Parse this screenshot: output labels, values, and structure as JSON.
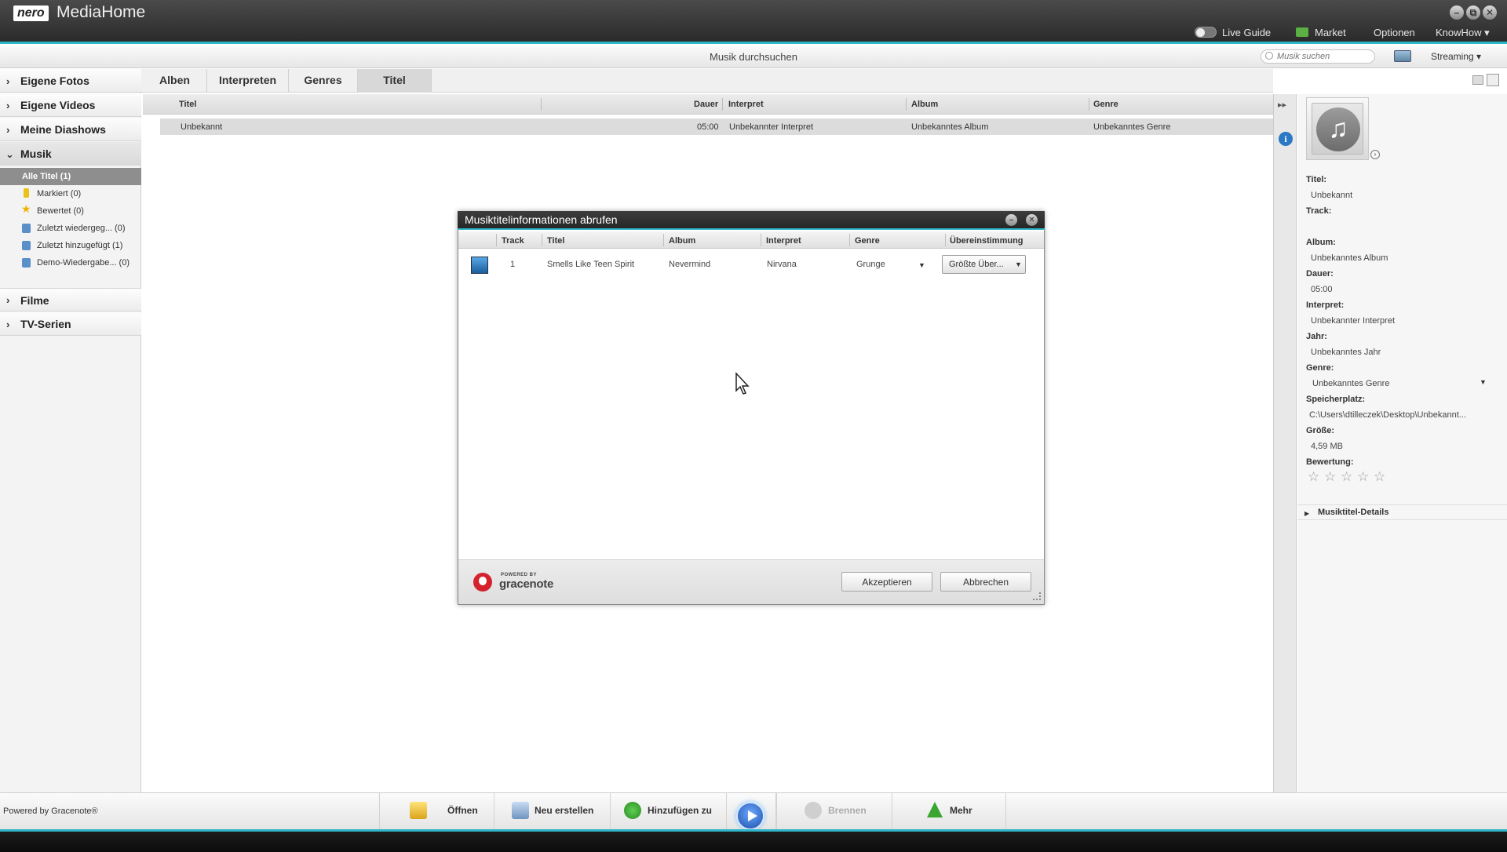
{
  "app": {
    "logo": "nero",
    "name": "MediaHome"
  },
  "window_controls": [
    "–",
    "⧉",
    "✕"
  ],
  "topnav": {
    "live_guide": "Live Guide",
    "market": "Market",
    "options": "Optionen",
    "knowhow": "KnowHow ▾"
  },
  "subheader": {
    "title": "Musik durchsuchen",
    "search_placeholder": "Musik suchen",
    "streaming": "Streaming ▾"
  },
  "sidebar": {
    "categories": [
      "Eigene Fotos",
      "Eigene Videos",
      "Meine Diashows",
      "Musik",
      "Filme",
      "TV-Serien"
    ],
    "music_items": [
      "Alle Titel (1)",
      "Markiert (0)",
      "Bewertet (0)",
      "Zuletzt wiedergeg... (0)",
      "Zuletzt hinzugefügt (1)",
      "Demo-Wiedergabe... (0)"
    ]
  },
  "tabs": [
    "Alben",
    "Interpreten",
    "Genres",
    "Titel"
  ],
  "table": {
    "columns": [
      "Titel",
      "Dauer",
      "Interpret",
      "Album",
      "Genre"
    ],
    "rows": [
      {
        "title": "Unbekannt",
        "duration": "05:00",
        "artist": "Unbekannter Interpret",
        "album": "Unbekanntes Album",
        "genre": "Unbekanntes Genre"
      }
    ]
  },
  "details_panel": {
    "fields": [
      {
        "label": "Titel:",
        "value": "Unbekannt"
      },
      {
        "label": "Track:",
        "value": ""
      },
      {
        "label": "Album:",
        "value": "Unbekanntes Album"
      },
      {
        "label": "Dauer:",
        "value": "05:00"
      },
      {
        "label": "Interpret:",
        "value": "Unbekannter Interpret"
      },
      {
        "label": "Jahr:",
        "value": "Unbekanntes Jahr"
      },
      {
        "label": "Genre:",
        "value": "Unbekanntes Genre"
      },
      {
        "label": "Speicherplatz:",
        "value": "C:\\Users\\dtilleczek\\Desktop\\Unbekannt..."
      },
      {
        "label": "Größe:",
        "value": "4,59 MB"
      },
      {
        "label": "Bewertung:",
        "value": ""
      }
    ],
    "rating_stars": [
      "☆",
      "☆",
      "☆",
      "☆",
      "☆"
    ],
    "section": "Musiktitel-Details"
  },
  "dialog": {
    "title": "Musiktitelinformationen abrufen",
    "columns": [
      "Track",
      "Titel",
      "Album",
      "Interpret",
      "Genre",
      "Übereinstimmung"
    ],
    "row": {
      "track": "1",
      "title": "Smells Like Teen Spirit",
      "album": "Nevermind",
      "artist": "Nirvana",
      "genre": "Grunge",
      "match": "Größte Über..."
    },
    "powered_by": "POWERED BY",
    "brand": "gracenote",
    "accept": "Akzeptieren",
    "cancel": "Abbrechen"
  },
  "bottombar": {
    "powered": "Powered by Gracenote®",
    "buttons": [
      "Öffnen",
      "Neu erstellen",
      "Hinzufügen zu",
      "Brennen",
      "Mehr"
    ]
  },
  "colors": {
    "accent": "#2fb6c9",
    "gracenote_red": "#d3232d",
    "play_blue": "#1a4fa8"
  },
  "icons": {
    "market": "market-cart-icon",
    "search": "search-icon",
    "info": "info-icon",
    "music": "music-note-icon",
    "play": "play-icon"
  }
}
